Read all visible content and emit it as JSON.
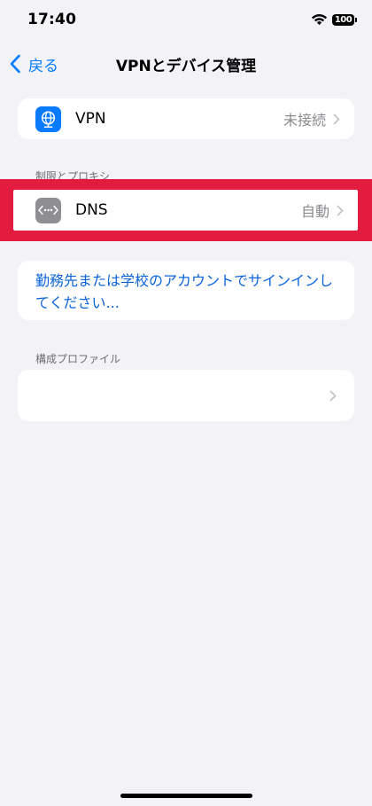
{
  "status_bar": {
    "time": "17:40",
    "battery": "100",
    "wifi_icon": "wifi-icon"
  },
  "nav": {
    "back_label": "戻る",
    "title": "VPNとデバイス管理"
  },
  "vpn_row": {
    "label": "VPN",
    "value": "未接続",
    "icon": "globe-icon",
    "icon_color": "#0a7aff"
  },
  "proxy_section": {
    "header": "制限とプロキシ"
  },
  "dns_row": {
    "label": "DNS",
    "value": "自動",
    "icon": "dns-dots-icon",
    "icon_color": "#8e8e93"
  },
  "signin": {
    "text": "勤務先または学校のアカウントでサインインしてください..."
  },
  "profiles_section": {
    "header": "構成プロファイル"
  },
  "colors": {
    "accent": "#007aff",
    "highlight": "#e31b3f",
    "background": "#f2f2f7"
  }
}
